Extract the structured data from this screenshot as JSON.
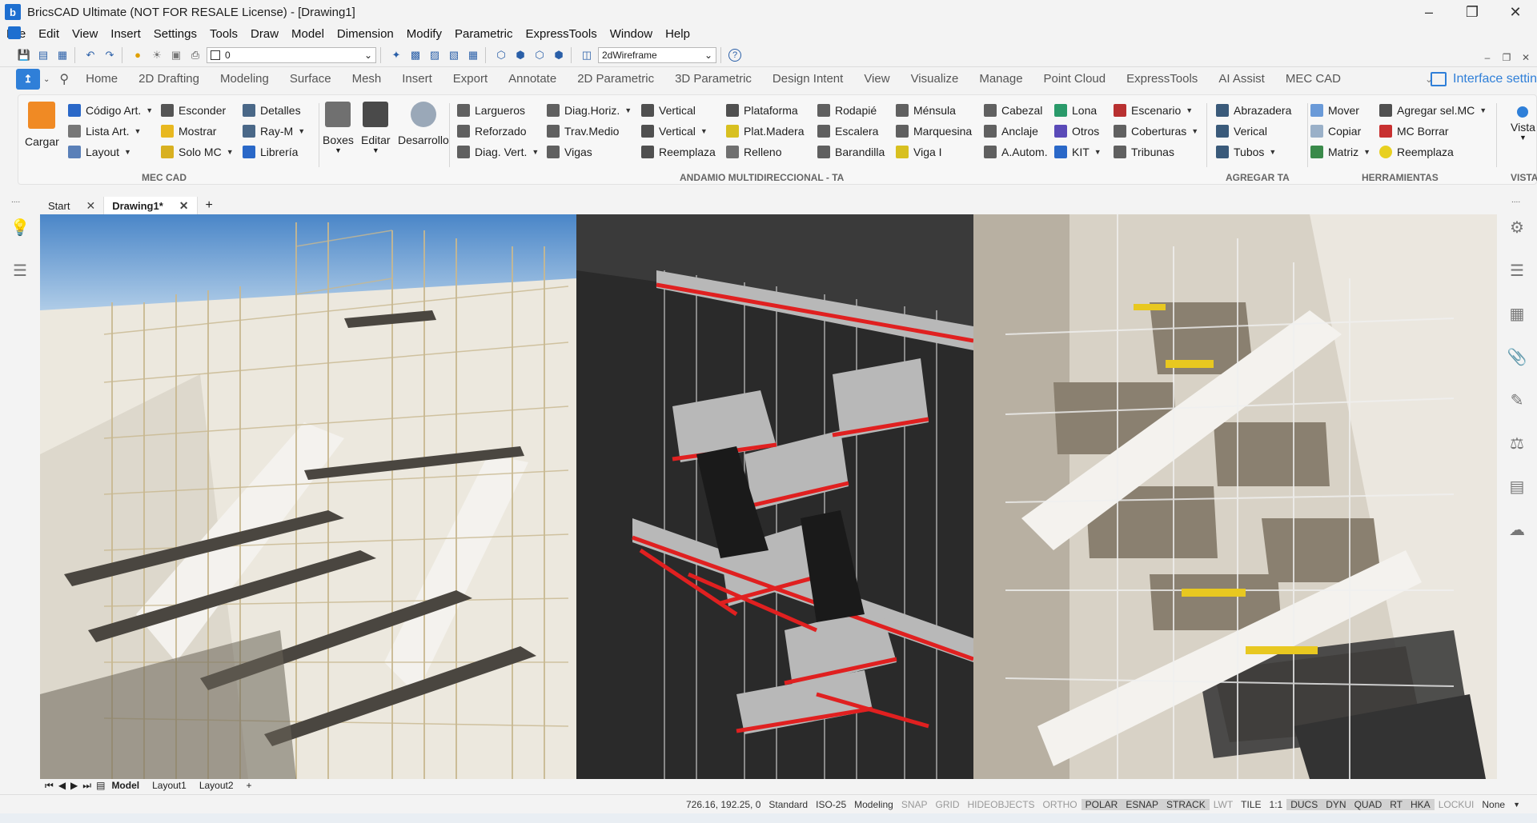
{
  "app": {
    "title": "BricsCAD Ultimate (NOT FOR RESALE License) - [Drawing1]",
    "logo": "bricscad-logo"
  },
  "menubar": [
    "File",
    "Edit",
    "View",
    "Insert",
    "Settings",
    "Tools",
    "Draw",
    "Model",
    "Dimension",
    "Modify",
    "Parametric",
    "ExpressTools",
    "Window",
    "Help"
  ],
  "quickbar": {
    "layer_value": "0",
    "visualstyle_value": "2dWireframe"
  },
  "ribbon_tabs": [
    "Home",
    "2D Drafting",
    "Modeling",
    "Surface",
    "Mesh",
    "Insert",
    "Export",
    "Annotate",
    "2D Parametric",
    "3D Parametric",
    "Design Intent",
    "View",
    "Visualize",
    "Manage",
    "Point Cloud",
    "ExpressTools",
    "AI Assist",
    "MEC CAD"
  ],
  "interface_settings": "Interface settin",
  "ribbon": {
    "mec_cad": {
      "label": "MEC CAD",
      "cargar": "Cargar",
      "col1": [
        "Código Art.",
        "Lista Art.",
        "Layout"
      ],
      "col2": [
        "Esconder",
        "Mostrar",
        "Solo MC"
      ],
      "col3": [
        "Detalles",
        "Ray-M",
        "Librería"
      ],
      "boxes": "Boxes",
      "editar": "Editar",
      "desarrollo": "Desarrollo"
    },
    "andamio": {
      "label": "ANDAMIO MULTIDIRECCIONAL - TA",
      "col1": [
        "Largueros",
        "Reforzado",
        "Diag. Vert."
      ],
      "col2": [
        "Diag.Horiz.",
        "Trav.Medio",
        "Vigas"
      ],
      "col3": [
        "Vertical",
        "Vertical",
        "Reemplaza"
      ],
      "col4": [
        "Plataforma",
        "Plat.Madera",
        "Relleno"
      ],
      "col5": [
        "Rodapié",
        "Escalera",
        "Barandilla"
      ],
      "col6": [
        "Ménsula",
        "Marquesina",
        "Viga I"
      ],
      "col7": [
        "Cabezal",
        "Anclaje",
        "A.Autom."
      ],
      "col8": [
        "Lona",
        "Otros",
        "KIT"
      ],
      "col9": [
        "Escenario",
        "Coberturas",
        "Tribunas"
      ]
    },
    "agregar": {
      "label": "AGREGAR TA",
      "items": [
        "Abrazadera",
        "Verical",
        "Tubos"
      ]
    },
    "herramientas": {
      "label": "HERRAMIENTAS",
      "col1": [
        "Mover",
        "Copiar",
        "Matriz"
      ],
      "col2": [
        "Agregar sel.MC",
        "MC Borrar",
        "Reemplaza"
      ]
    },
    "vista": {
      "label": "VISTA",
      "item": "Vista"
    }
  },
  "doc_tabs": [
    "Start",
    "Drawing1*"
  ],
  "layout_tabs": [
    "Model",
    "Layout1",
    "Layout2"
  ],
  "status": {
    "coords": "726.16, 192.25, 0",
    "items": [
      "Standard",
      "ISO-25",
      "Modeling",
      "SNAP",
      "GRID",
      "HIDEOBJECTS",
      "ORTHO",
      "POLAR",
      "ESNAP",
      "STRACK",
      "LWT",
      "TILE",
      "1:1",
      "DUCS",
      "DYN",
      "QUAD",
      "RT",
      "HKA",
      "LOCKUI",
      "None"
    ],
    "on": [
      "Standard",
      "ISO-25",
      "Modeling",
      "POLAR",
      "ESNAP",
      "STRACK",
      "TILE",
      "1:1",
      "DUCS",
      "DYN",
      "QUAD",
      "RT",
      "HKA",
      "None"
    ]
  },
  "colors": {
    "accent": "#2f7fd8",
    "scaffold_red": "#e02020",
    "sky": "#6aa0d8"
  }
}
